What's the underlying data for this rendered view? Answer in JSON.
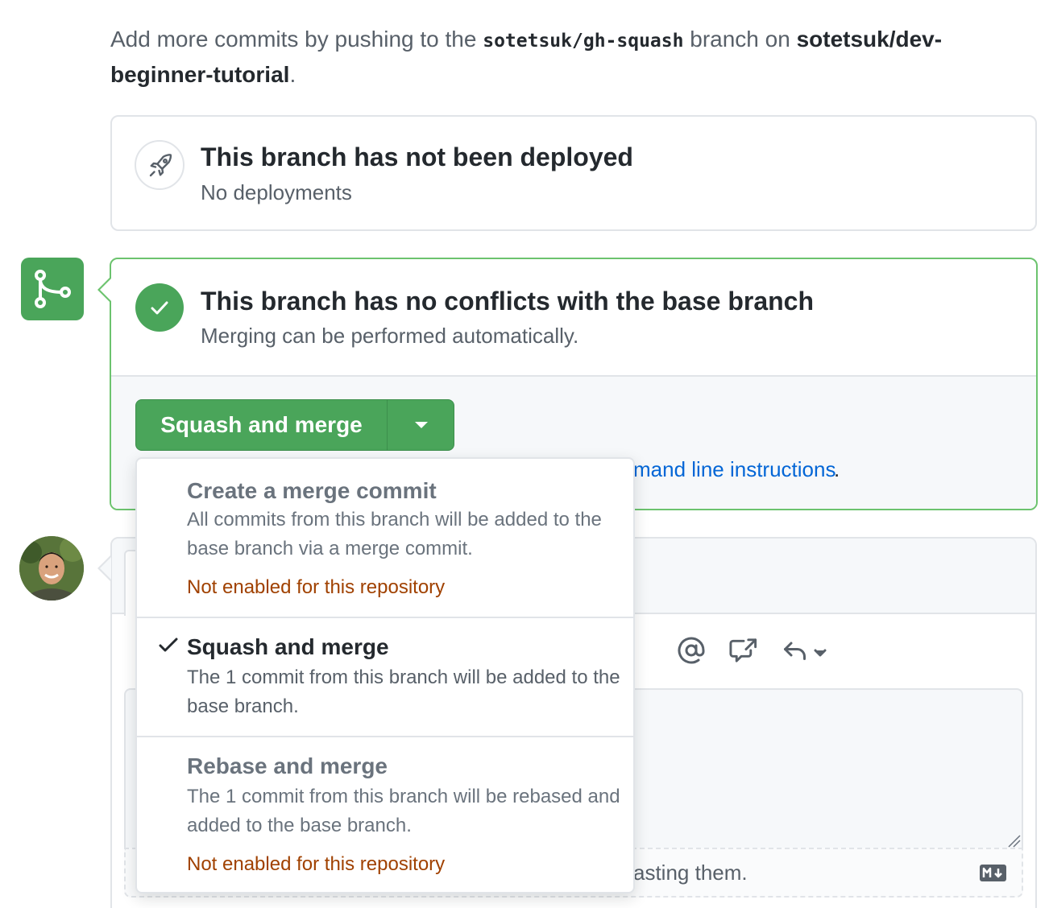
{
  "intro": {
    "prefix": "Add more commits by pushing to the ",
    "branch": "sotetsuk/gh-squash",
    "middle": " branch on ",
    "repo": "sotetsuk/dev-beginner-tutorial",
    "suffix": "."
  },
  "deployment": {
    "icon": "rocket-icon",
    "title": "This branch has not been deployed",
    "subtitle": "No deployments"
  },
  "merge_status": {
    "badge_icon": "git-merge-icon",
    "status_icon": "check-icon",
    "title": "This branch has no conflicts with the base branch",
    "subtitle": "Merging can be performed automatically.",
    "merge_button_label": "Squash and merge",
    "caret_icon": "triangle-down-icon",
    "cmd_link_partial": "mand line instructions",
    "cmd_period": "."
  },
  "merge_menu": {
    "options": [
      {
        "title": "Create a merge commit",
        "description": "All commits from this branch will be added to the base branch via a merge commit.",
        "warning": "Not enabled for this repository",
        "selected": false
      },
      {
        "title": "Squash and merge",
        "description": "The 1 commit from this branch will be added to the base branch.",
        "warning": "",
        "selected": true
      },
      {
        "title": "Rebase and merge",
        "description": "The 1 commit from this branch will be rebased and added to the base branch.",
        "warning": "Not enabled for this repository",
        "selected": false
      }
    ]
  },
  "comment": {
    "toolbar_icons": [
      "mention-icon",
      "cross-reference-icon",
      "reply-icon"
    ],
    "attach_partial": "asting them.",
    "markdown_icon": "markdown-icon"
  },
  "colors": {
    "green": "#4aa55a",
    "green_border": "#6cc36e",
    "link": "#0366d6",
    "warning": "#a04100",
    "muted_text": "#586069"
  }
}
